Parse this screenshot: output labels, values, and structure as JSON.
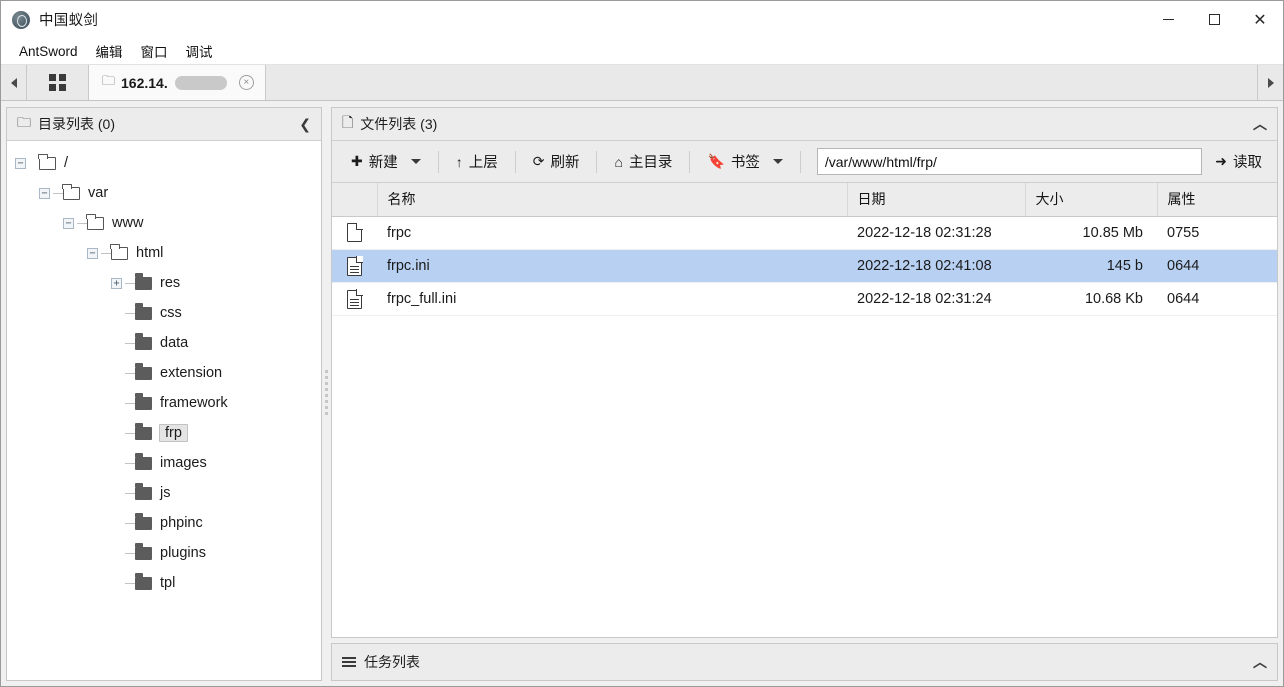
{
  "window": {
    "title": "中国蚁剑",
    "app_icon": "antsword-logo-icon",
    "controls": {
      "minimize": "minimize-icon",
      "maximize": "maximize-icon",
      "close": "close-icon"
    }
  },
  "menubar": {
    "items": [
      {
        "label": "AntSword"
      },
      {
        "label": "编辑"
      },
      {
        "label": "窗口"
      },
      {
        "label": "调试"
      }
    ]
  },
  "tabbar": {
    "scroll_left": "chevron-left-icon",
    "scroll_right": "chevron-right-icon",
    "grid_button": "grid-view-icon",
    "tabs": [
      {
        "label": "162.14.",
        "folder_icon": "folder-icon",
        "redacted": true,
        "close": "×"
      }
    ]
  },
  "directory_panel": {
    "title": "目录列表 (0)",
    "title_icon": "folder-icon",
    "collapse": "chevron-left-icon",
    "tree": [
      {
        "label": "/",
        "depth": 0,
        "toggle": "−",
        "icon": "folder-open-icon",
        "selected": false
      },
      {
        "label": "var",
        "depth": 1,
        "toggle": "−",
        "icon": "folder-open-icon",
        "selected": false
      },
      {
        "label": "www",
        "depth": 2,
        "toggle": "−",
        "icon": "folder-open-icon",
        "selected": false
      },
      {
        "label": "html",
        "depth": 3,
        "toggle": "−",
        "icon": "folder-open-icon",
        "selected": false
      },
      {
        "label": "res",
        "depth": 4,
        "toggle": "+",
        "icon": "folder-icon",
        "selected": false
      },
      {
        "label": "css",
        "depth": 4,
        "toggle": "",
        "icon": "folder-icon",
        "selected": false
      },
      {
        "label": "data",
        "depth": 4,
        "toggle": "",
        "icon": "folder-icon",
        "selected": false
      },
      {
        "label": "extension",
        "depth": 4,
        "toggle": "",
        "icon": "folder-icon",
        "selected": false
      },
      {
        "label": "framework",
        "depth": 4,
        "toggle": "",
        "icon": "folder-icon",
        "selected": false
      },
      {
        "label": "frp",
        "depth": 4,
        "toggle": "",
        "icon": "folder-icon",
        "selected": true
      },
      {
        "label": "images",
        "depth": 4,
        "toggle": "",
        "icon": "folder-icon",
        "selected": false
      },
      {
        "label": "js",
        "depth": 4,
        "toggle": "",
        "icon": "folder-icon",
        "selected": false
      },
      {
        "label": "phpinc",
        "depth": 4,
        "toggle": "",
        "icon": "folder-icon",
        "selected": false
      },
      {
        "label": "plugins",
        "depth": 4,
        "toggle": "",
        "icon": "folder-icon",
        "selected": false
      },
      {
        "label": "tpl",
        "depth": 4,
        "toggle": "",
        "icon": "folder-icon",
        "selected": false
      }
    ]
  },
  "file_panel": {
    "title": "文件列表 (3)",
    "title_icon": "file-icon",
    "collapse": "chevron-up-icon",
    "toolbar": {
      "new_label": "新建",
      "new_icon": "plus-circle-icon",
      "up_label": "上层",
      "up_icon": "arrow-up-icon",
      "refresh_label": "刷新",
      "refresh_icon": "refresh-icon",
      "home_label": "主目录",
      "home_icon": "home-icon",
      "bookmark_label": "书签",
      "bookmark_icon": "bookmark-icon",
      "read_label": "读取",
      "read_icon": "arrow-right-icon"
    },
    "path": {
      "value": "/var/www/html/frp/",
      "placeholder": ""
    },
    "columns": [
      "名称",
      "日期",
      "大小",
      "属性"
    ],
    "rows": [
      {
        "icon": "file-blank-icon",
        "name": "frpc",
        "date": "2022-12-18 02:31:28",
        "size": "10.85 Mb",
        "attr": "0755",
        "selected": false
      },
      {
        "icon": "file-text-icon",
        "name": "frpc.ini",
        "date": "2022-12-18 02:41:08",
        "size": "145 b",
        "attr": "0644",
        "selected": true
      },
      {
        "icon": "file-text-icon",
        "name": "frpc_full.ini",
        "date": "2022-12-18 02:31:24",
        "size": "10.68 Kb",
        "attr": "0644",
        "selected": false
      }
    ]
  },
  "task_panel": {
    "title": "任务列表",
    "title_icon": "list-icon",
    "collapse": "chevron-up-icon"
  },
  "colors": {
    "selection": "#b8d1f3",
    "chrome": "#ececec",
    "border": "#c8c8c8"
  }
}
